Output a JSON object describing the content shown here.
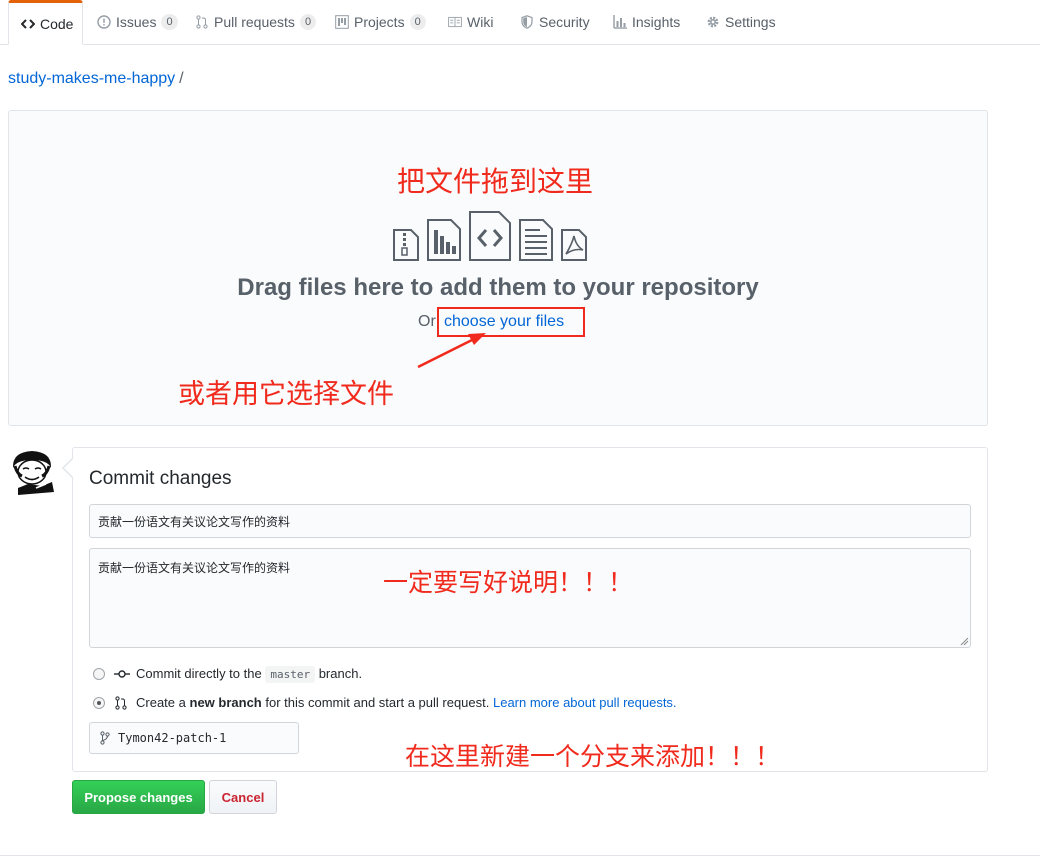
{
  "tabs": [
    {
      "label": "Code",
      "icon": "code-icon",
      "selected": true
    },
    {
      "label": "Issues",
      "icon": "issue-icon",
      "count": "0"
    },
    {
      "label": "Pull requests",
      "icon": "pull-request-icon",
      "count": "0"
    },
    {
      "label": "Projects",
      "icon": "project-icon",
      "count": "0"
    },
    {
      "label": "Wiki",
      "icon": "book-icon"
    },
    {
      "label": "Security",
      "icon": "shield-icon"
    },
    {
      "label": "Insights",
      "icon": "graph-icon"
    },
    {
      "label": "Settings",
      "icon": "gear-icon"
    }
  ],
  "breadcrumb": {
    "repo": "study-makes-me-happy",
    "separator": "/"
  },
  "dropzone": {
    "annotation_top": "把文件拖到这里",
    "title": "Drag files here to add them to your repository",
    "or_text": "Or",
    "choose_link": "choose your files",
    "annotation_choose": "或者用它选择文件",
    "file_icons": [
      "file-zip-icon",
      "file-chart-icon",
      "file-code-icon",
      "file-text-icon",
      "file-pdf-icon"
    ]
  },
  "commit": {
    "title": "Commit changes",
    "summary_value": "贡献一份语文有关议论文写作的资料",
    "description_value": "贡献一份语文有关议论文写作的资料",
    "annotation_description": "一定要写好说明！！！",
    "option_direct": {
      "prefix": "Commit directly to the",
      "branch": "master",
      "suffix": "branch."
    },
    "option_new": {
      "prefix": "Create a",
      "bold": "new branch",
      "middle": "for this commit and start a pull request.",
      "link": "Learn more about pull requests."
    },
    "selected_option": "new-branch",
    "branch_name": "Tymon42-patch-1",
    "annotation_branch": "在这里新建一个分支来添加！！！"
  },
  "buttons": {
    "propose": "Propose changes",
    "cancel": "Cancel"
  },
  "colors": {
    "annotation": "#f02a1c",
    "link": "#0366d6",
    "primary": "#28a745",
    "danger": "#cb2431",
    "tab_accent": "#e36209"
  }
}
